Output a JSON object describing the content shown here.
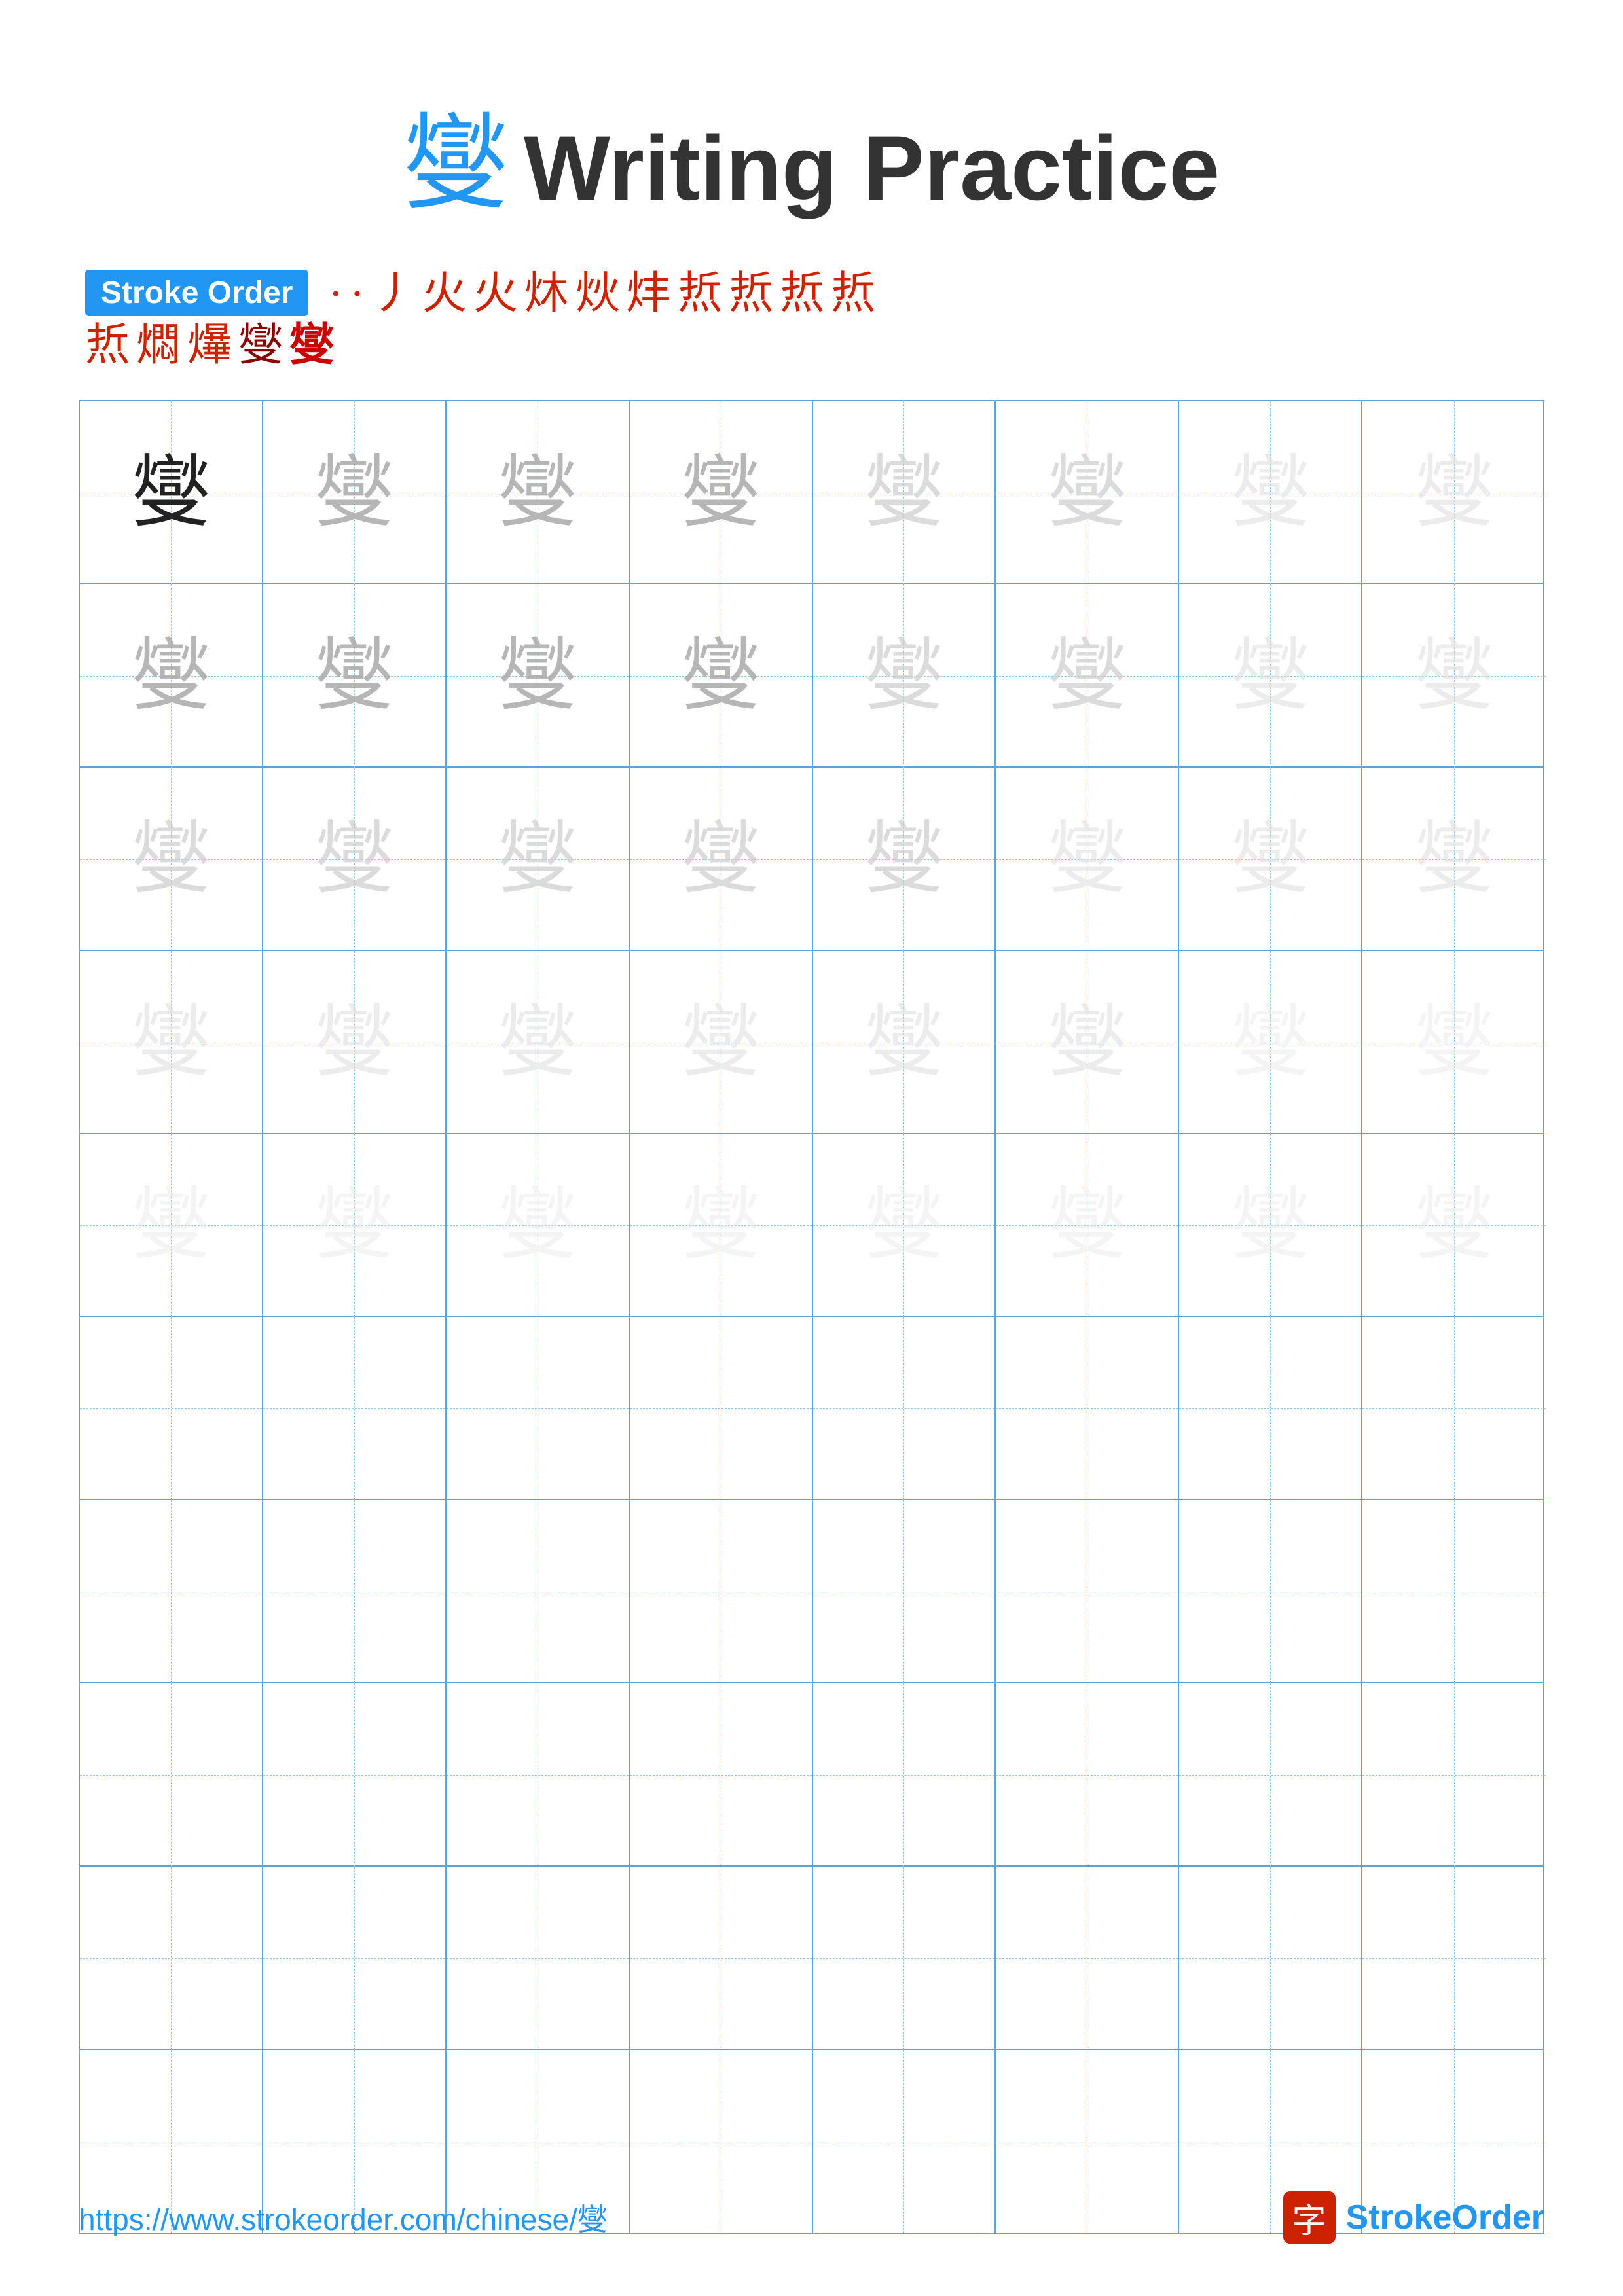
{
  "title": {
    "char": "燮",
    "text": "Writing Practice"
  },
  "stroke_order": {
    "label": "Stroke Order",
    "chars": [
      "·",
      "·",
      "丿",
      "火",
      "火",
      "炑",
      "炏",
      "炐",
      "焎",
      "焎",
      "焎",
      "焎",
      "燜",
      "爗",
      "燮",
      "燮"
    ]
  },
  "practice_char": "燮",
  "grid": {
    "rows": 10,
    "cols": 8
  },
  "footer": {
    "url": "https://www.strokeorder.com/chinese/燮",
    "logo_char": "字",
    "logo_text_stroke": "Stroke",
    "logo_text_order": "Order"
  }
}
